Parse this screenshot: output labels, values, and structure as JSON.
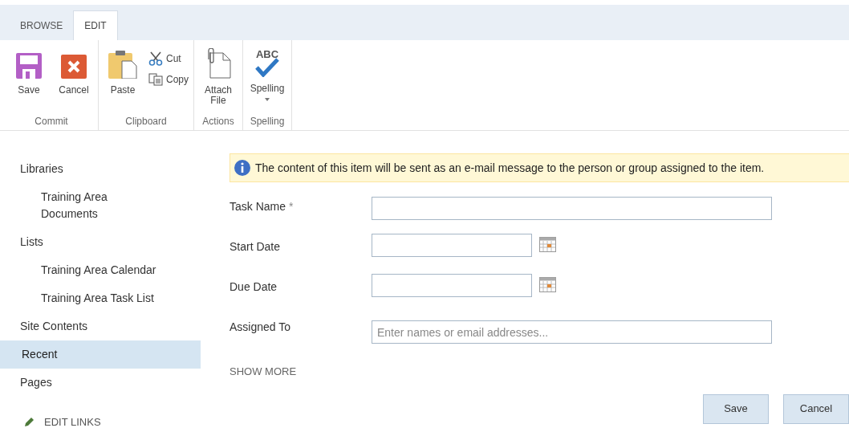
{
  "ribbon_tabs": [
    {
      "label": "BROWSE",
      "selected": false
    },
    {
      "label": "EDIT",
      "selected": true
    }
  ],
  "ribbon_groups": [
    {
      "label": "Commit",
      "commands": [
        {
          "kind": "save",
          "label": "Save"
        },
        {
          "kind": "cancel",
          "label": "Cancel"
        }
      ]
    },
    {
      "label": "Clipboard",
      "commands": [
        {
          "kind": "paste",
          "label": "Paste"
        },
        {
          "kind": "cut",
          "label": "Cut"
        },
        {
          "kind": "copy",
          "label": "Copy"
        }
      ]
    },
    {
      "label": "Actions",
      "commands": [
        {
          "kind": "attach",
          "label": "Attach File"
        }
      ]
    },
    {
      "label": "Spelling",
      "commands": [
        {
          "kind": "spelling",
          "label": "Spelling",
          "glyph": "ABC"
        }
      ]
    }
  ],
  "sidebar": {
    "items": [
      {
        "label": "Libraries",
        "selected": false,
        "children": [
          {
            "label": "Training Area Documents",
            "selected": false
          }
        ]
      },
      {
        "label": "Lists",
        "selected": false,
        "children": [
          {
            "label": "Training Area Calendar",
            "selected": false
          },
          {
            "label": "Training Area Task List",
            "selected": false
          }
        ]
      },
      {
        "label": "Site Contents",
        "selected": false
      },
      {
        "label": "Recent",
        "selected": true
      },
      {
        "label": "Pages",
        "selected": false
      }
    ],
    "edit_links": "EDIT LINKS"
  },
  "notice": "The content of this item will be sent as an e-mail message to the person or group assigned to the item.",
  "fields": [
    {
      "label": "Task Name",
      "required_mark": "*",
      "kind": "text"
    },
    {
      "label": "Start Date",
      "kind": "date"
    },
    {
      "label": "Due Date",
      "kind": "date"
    },
    {
      "label": "Assigned To",
      "kind": "people",
      "placeholder": "Enter names or email addresses..."
    }
  ],
  "show_more": "SHOW MORE",
  "buttons": [
    "Save",
    "Cancel"
  ]
}
